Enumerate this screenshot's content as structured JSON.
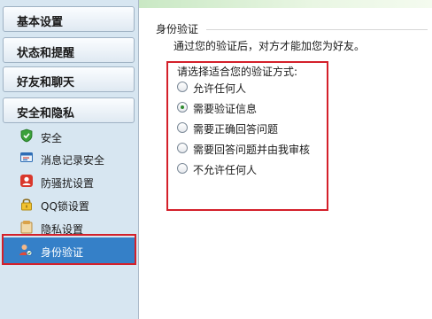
{
  "sidebar": {
    "categories": [
      "基本设置",
      "状态和提醒",
      "好友和聊天",
      "安全和隐私"
    ],
    "items": [
      {
        "label": "安全",
        "icon": "shield-icon"
      },
      {
        "label": "消息记录安全",
        "icon": "chat-record-icon"
      },
      {
        "label": "防骚扰设置",
        "icon": "anti-harass-icon"
      },
      {
        "label": "QQ锁设置",
        "icon": "lock-icon"
      },
      {
        "label": "隐私设置",
        "icon": "privacy-icon"
      },
      {
        "label": "身份验证",
        "icon": "user-verify-icon",
        "selected": true
      }
    ]
  },
  "main": {
    "section_title": "身份验证",
    "description": "通过您的验证后，对方才能加您为好友。",
    "prompt": "请选择适合您的验证方式:",
    "options": [
      {
        "label": "允许任何人",
        "checked": false
      },
      {
        "label": "需要验证信息",
        "checked": true
      },
      {
        "label": "需要正确回答问题",
        "checked": false
      },
      {
        "label": "需要回答问题并由我审核",
        "checked": false
      },
      {
        "label": "不允许任何人",
        "checked": false
      }
    ]
  },
  "colors": {
    "highlight_border": "#d4202a",
    "selected_bg": "#3580c8",
    "sidebar_bg": "#d7e6f1"
  }
}
